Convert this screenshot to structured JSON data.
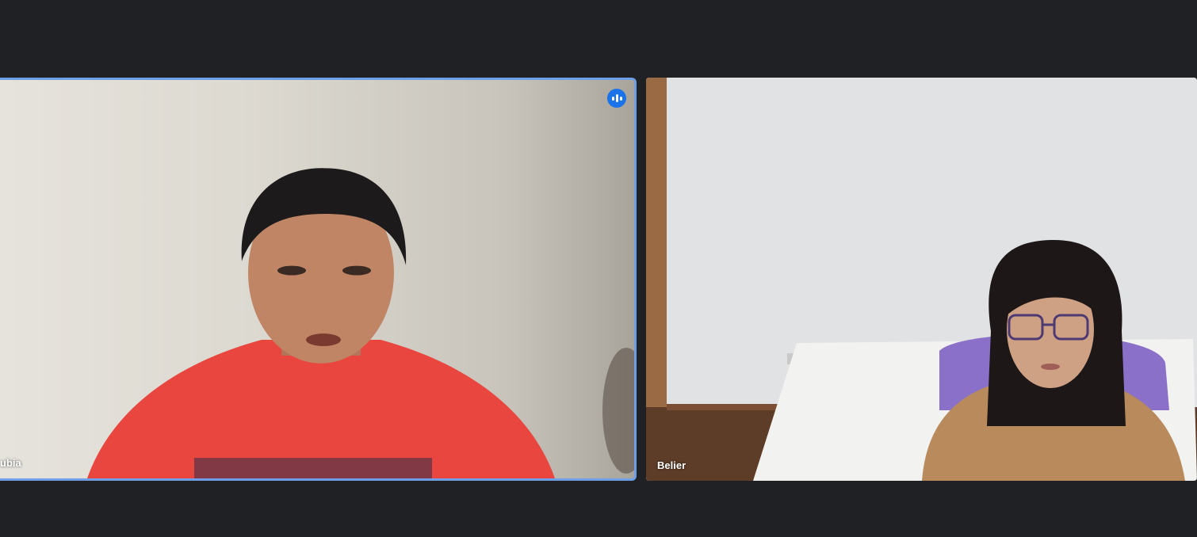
{
  "participants": [
    {
      "name": "ubia",
      "active_speaker": true
    },
    {
      "name": "Belier",
      "active_speaker": false
    }
  ],
  "colors": {
    "background": "#202124",
    "active_border": "#6f9fe6",
    "speaking_indicator": "#1a73e8"
  },
  "icons": {
    "speaking": "audio-level-icon"
  }
}
